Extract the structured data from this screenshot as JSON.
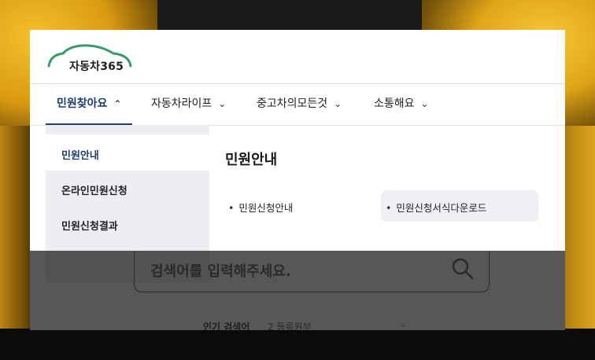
{
  "brand": {
    "logo_text": "자동차365"
  },
  "nav": {
    "items": [
      {
        "label": "민원찾아요",
        "chevron": "^",
        "active": true
      },
      {
        "label": "자동차라이프",
        "chevron": "v"
      },
      {
        "label": "중고차의모든것",
        "chevron": "v"
      },
      {
        "label": "소통해요",
        "chevron": "v"
      }
    ]
  },
  "sidebar": {
    "items": [
      {
        "label": "민원안내",
        "active": true
      },
      {
        "label": "온라인민원신청"
      },
      {
        "label": "민원신청결과"
      }
    ]
  },
  "panel": {
    "title": "민원안내",
    "links": [
      {
        "label": "민원신청안내"
      },
      {
        "label": "민원신청서식다운로드"
      }
    ]
  },
  "search": {
    "placeholder": "검색어를 입력해주세요.",
    "popular_label": "인기 검색어",
    "popular_first": "2  등록원부",
    "popular_dash": "-"
  },
  "colors": {
    "accent": "#1d3c72",
    "logo_green": "#3a9a6b"
  }
}
